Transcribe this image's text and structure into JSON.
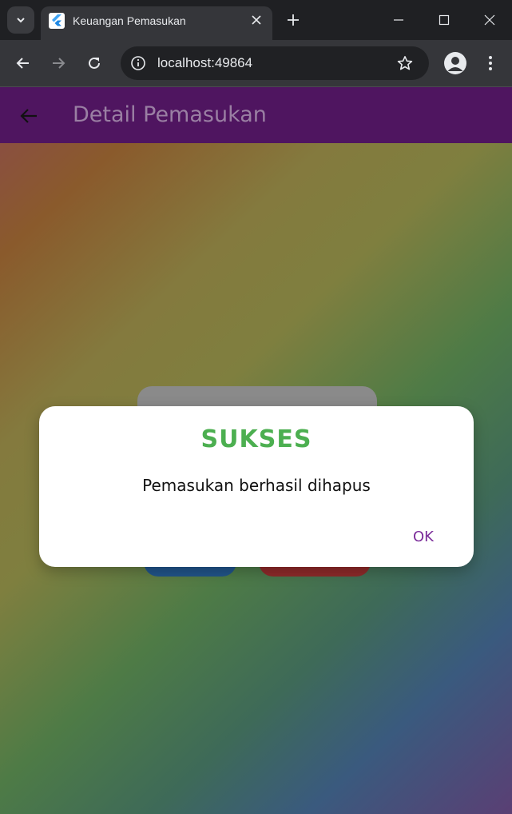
{
  "browser": {
    "tab_title": "Keuangan Pemasukan",
    "url": "localhost:49864",
    "favicon": "flutter-icon"
  },
  "app": {
    "title": "Detail Pemasukan",
    "appbar_color": "#4f1560"
  },
  "dialog": {
    "title": "SUKSES",
    "message": "Pemasukan berhasil dihapus",
    "ok_label": "OK",
    "title_color": "#4caf50",
    "ok_color": "#7b2d9a"
  },
  "icons": {
    "tab_menu": "chevron-down-icon",
    "tab_close": "close-icon",
    "new_tab": "plus-icon",
    "minimize": "minimize-icon",
    "maximize": "maximize-icon",
    "close_window": "close-icon",
    "back": "arrow-left-icon",
    "forward": "arrow-right-icon",
    "reload": "reload-icon",
    "site_info": "info-icon",
    "bookmark": "star-icon",
    "profile": "person-icon",
    "menu": "kebab-menu-icon",
    "app_back": "arrow-left-icon"
  }
}
